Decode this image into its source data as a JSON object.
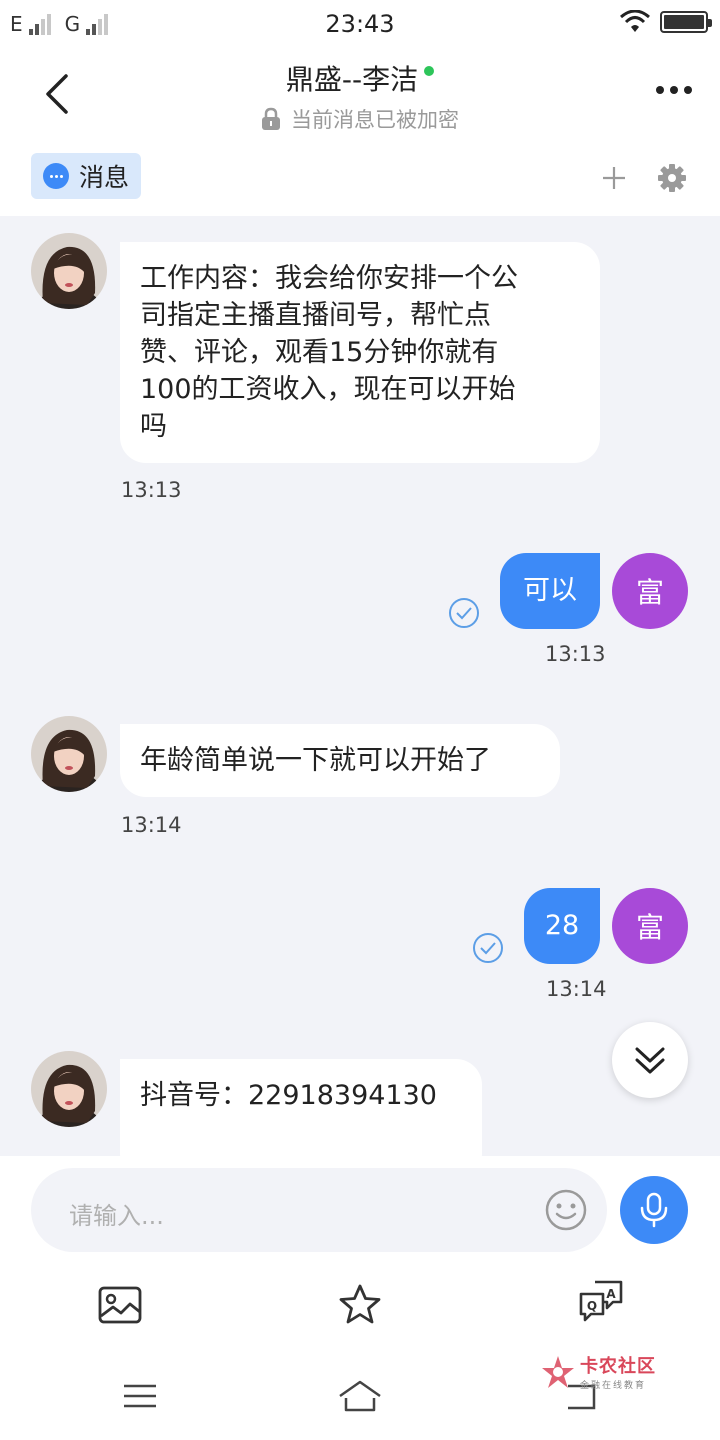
{
  "status_bar": {
    "carrier1": "E",
    "carrier2": "G",
    "time": "23:43"
  },
  "header": {
    "contact_name": "鼎盛--李洁",
    "online_status_color": "#2dc55a",
    "encryption_notice": "当前消息已被加密",
    "back_icon": "chevron-left-icon",
    "more_icon": "more-dots-icon"
  },
  "tabs": {
    "active_tab_label": "消息",
    "active_tab_icon": "chat-bubble-icon",
    "add_icon": "plus-icon",
    "settings_icon": "gear-icon"
  },
  "messages": [
    {
      "direction": "incoming",
      "text": "工作内容：我会给你安排一个公司指定主播直播间号，帮忙点赞、评论，观看15分钟你就有100的工资收入，现在可以开始吗",
      "lines": [
        "工作内容：我会给你安排一个公",
        "司指定主播直播间号，帮忙点",
        "赞、评论，观看15分钟你就有",
        "100的工资收入，现在可以开始",
        "吗"
      ],
      "time": "13:13"
    },
    {
      "direction": "outgoing",
      "text": "可以",
      "time": "13:13",
      "read": true,
      "avatar_label": "富"
    },
    {
      "direction": "incoming",
      "text": "年龄简单说一下就可以开始了",
      "time": "13:14"
    },
    {
      "direction": "outgoing",
      "text": "28",
      "time": "13:14",
      "read": true,
      "avatar_label": "富"
    },
    {
      "direction": "incoming",
      "text": "抖音号：22918394130"
    }
  ],
  "composer": {
    "placeholder": "请输入...",
    "emoji_icon": "smiley-icon",
    "mic_icon": "microphone-icon"
  },
  "toolbar": {
    "items": [
      "image-icon",
      "star-icon",
      "qa-chat-icon"
    ]
  },
  "navbar": {
    "items": [
      "menu-icon",
      "home-icon",
      "back-icon"
    ]
  },
  "watermark": {
    "main": "卡农社区",
    "sub": "金融在线教育"
  },
  "colors": {
    "accent_blue": "#3d8af7",
    "self_avatar_purple": "#a84ad8",
    "chat_background": "#f2f3f8",
    "tab_highlight": "#d9e8fb"
  }
}
